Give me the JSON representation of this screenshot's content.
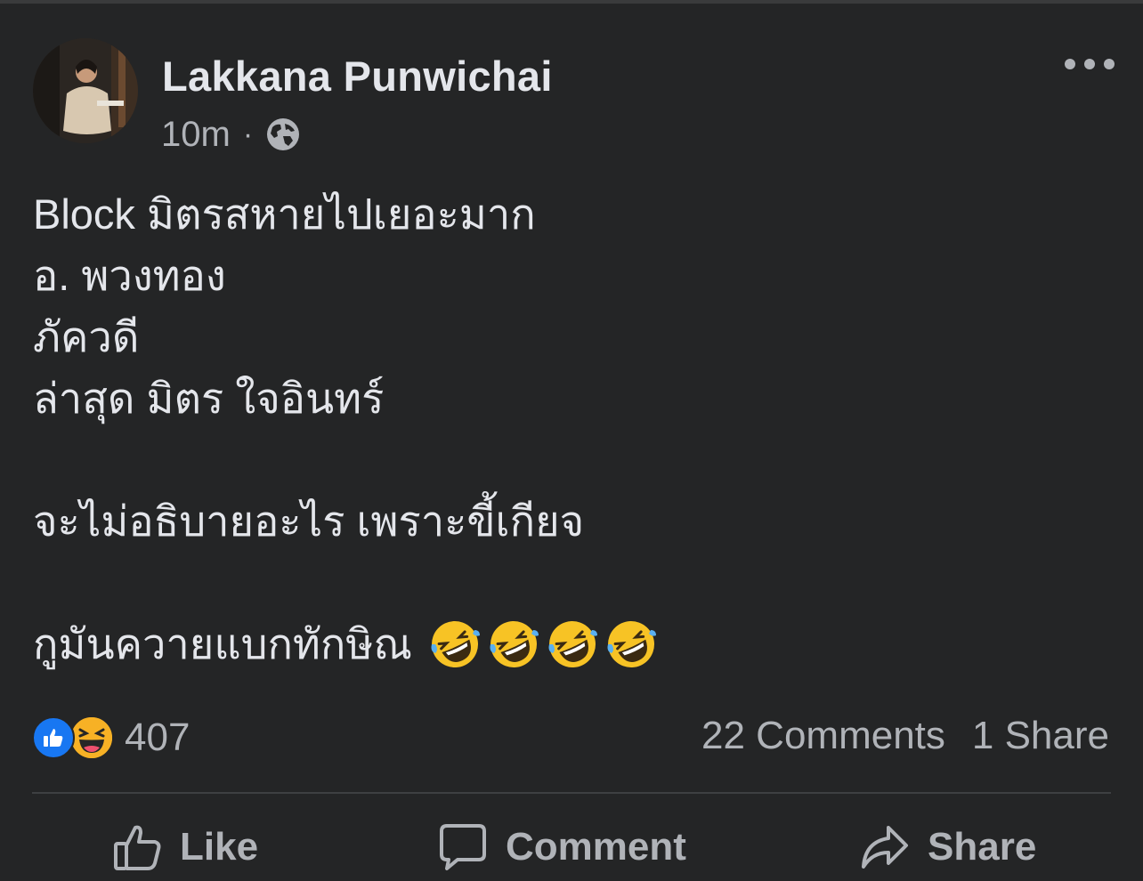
{
  "post": {
    "author": "Lakkana Punwichai",
    "time": "10m",
    "separator": "·",
    "privacy_icon": "globe-icon",
    "text_lines": [
      "Block มิตรสหายไปเยอะมาก",
      "อ. พวงทอง",
      "ภัควดี",
      "ล่าสุด มิตร ใจอินทร์",
      "",
      "จะไม่อธิบายอะไร เพราะขี้เกียจ",
      "",
      "กูมันควายแบกทักษิณ"
    ],
    "trailing_emoji": "rolling-on-floor-laughing",
    "trailing_emoji_count": 4
  },
  "engagement": {
    "reaction_icons": [
      "like-reaction-icon",
      "haha-reaction-icon"
    ],
    "reaction_count": "407",
    "comments": "22 Comments",
    "shares": "1 Share"
  },
  "actions": {
    "like": "Like",
    "comment": "Comment",
    "share": "Share"
  },
  "colors": {
    "background": "#242526",
    "primary_text": "#e4e6eb",
    "secondary_text": "#b0b3b8",
    "like_blue": "#1877f2",
    "haha_yellow": "#f7b125"
  }
}
